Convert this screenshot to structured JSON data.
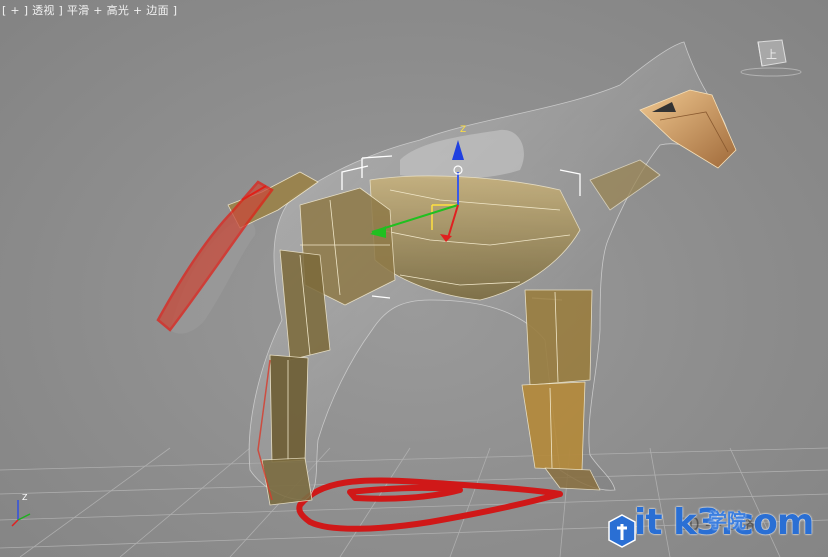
{
  "viewport": {
    "label": "[ + ] 透视 ] 平滑 + 高光 + 边面 ]"
  },
  "viewcube": {
    "face_label": "上"
  },
  "gizmo": {
    "z_label": "Z"
  },
  "axis_tripod": {
    "z_label": "Z"
  },
  "watermark": {
    "main_text": "it k3.com",
    "sub_text": "学院",
    "ghost_text": "10 — 3路"
  },
  "colors": {
    "background": "#8d8d8d",
    "grid": "#a8a8a8",
    "selection_red": "#e0201a",
    "mesh_tan": "#a58a4e",
    "gizmo_x": "#e02020",
    "gizmo_y": "#20c020",
    "gizmo_z": "#2040e0",
    "watermark_blue": "#2a6fd4"
  }
}
